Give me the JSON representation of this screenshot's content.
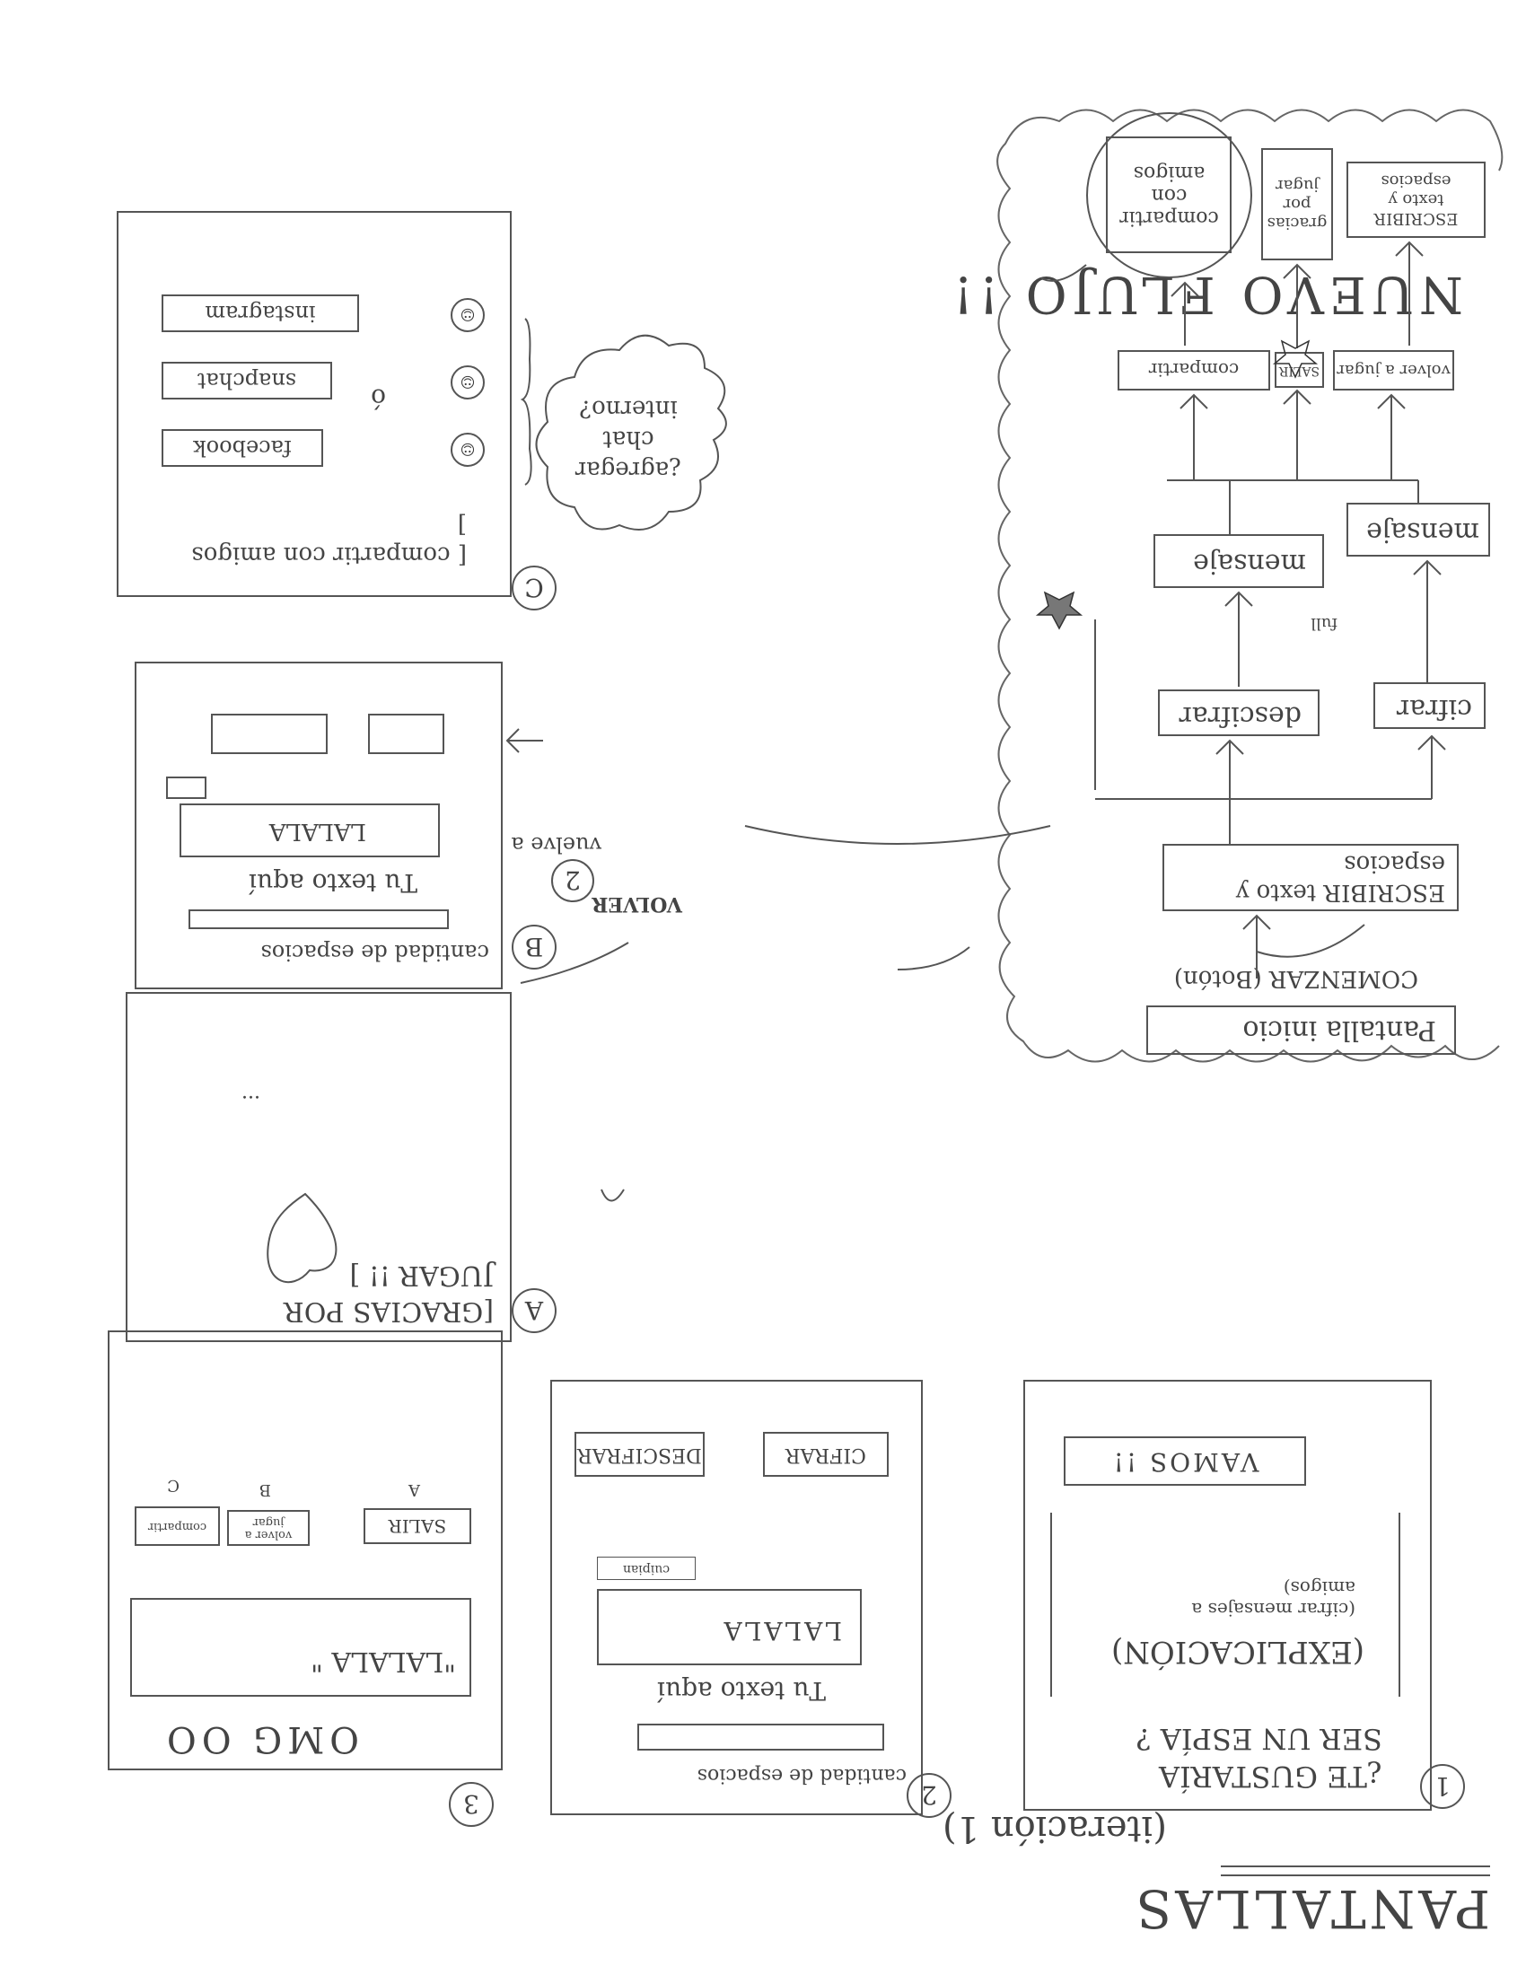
{
  "title": "PANTALLAS",
  "subtitle": "(iteración 1)",
  "screen1": {
    "number": "1",
    "question": "¿TE GUSTARÍA SER UN ESPÍA ?",
    "explanation": "(EXPLICACIÓN)",
    "note": "(cifrar mensajes a amigos)",
    "button": "VAMOS !!"
  },
  "screen2": {
    "number": "2",
    "spaces_label": "cantidad de espacios",
    "text_label": "Tu texto aquí",
    "text_value": "LALALA",
    "small_label": "cuipian",
    "cipher_button": "CIFRAR",
    "decipher_button": "DESCIFRAR"
  },
  "screen3": {
    "number": "3",
    "header": "OMG OO",
    "result": "\"LALALA \"",
    "exit_button": "SALIR",
    "back_button": "volver a jugar",
    "share_button": "compartir",
    "label_a": "A",
    "label_b": "B",
    "label_c": "C"
  },
  "screenA": {
    "letter": "A",
    "message": "[GRACIAS POR JUGAR !! ]",
    "dots": "..."
  },
  "screenB": {
    "letter": "B",
    "spaces_label": "cantidad de espacios",
    "text_label": "Tu texto aquí",
    "text_value": "LALALA",
    "badge_2": "2",
    "back_note": "vuelve a",
    "volver": "VOLVER"
  },
  "screenC": {
    "letter": "C",
    "share": "[ compartir con amigos ]",
    "facebook": "facebook",
    "snapchat": "snapchat",
    "instagram": "instagram",
    "or": "ó",
    "cloud": "¿agregar chat interno?"
  },
  "flow": {
    "heading": "NUEVO FLUJO !!",
    "start": "Pantalla inicio",
    "start_note": "COMENZAR (Botón)",
    "step_write": "ESCRIBIR texto y espacios",
    "decipher": "descifrar",
    "cipher": "cifrar",
    "message_left": "mensaje",
    "message_right": "mensaje",
    "share": "compartir",
    "exit": "SALIR",
    "play_again": "volver a jugar",
    "share_friends": "compartir con amigos",
    "thanks": "gracias por jugar",
    "write_again": "ESCRIBIR texto y espacios",
    "full": "full"
  }
}
